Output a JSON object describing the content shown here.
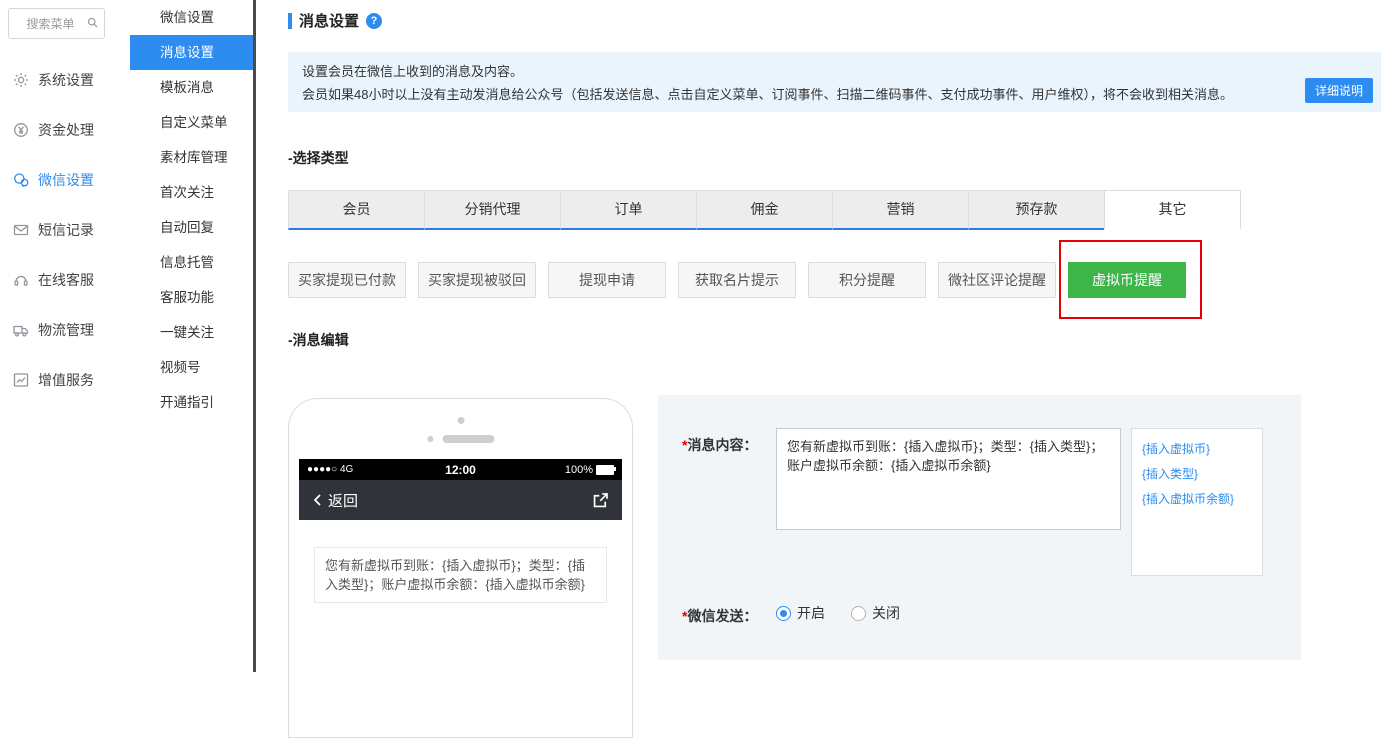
{
  "colors": {
    "accent": "#2d8cf0",
    "tab_underline": "#2c7be0",
    "active_green": "#3eb549",
    "annotation_red": "#e60000",
    "notice_bg": "#e9f4fd",
    "submenu_active_bg": "#2d8cf0"
  },
  "sidebar": {
    "search_placeholder": "搜索菜单",
    "items": [
      {
        "label": "系统设置",
        "icon": "gear-icon"
      },
      {
        "label": "资金处理",
        "icon": "money-icon"
      },
      {
        "label": "微信设置",
        "icon": "wechat-icon",
        "active": true
      },
      {
        "label": "短信记录",
        "icon": "mail-icon"
      },
      {
        "label": "在线客服",
        "icon": "headset-icon"
      },
      {
        "label": "物流管理",
        "icon": "truck-icon"
      },
      {
        "label": "增值服务",
        "icon": "chart-icon"
      }
    ]
  },
  "submenu": {
    "active": "消息设置",
    "items": [
      "微信设置",
      "消息设置",
      "模板消息",
      "自定义菜单",
      "素材库管理",
      "首次关注",
      "自动回复",
      "信息托管",
      "客服功能",
      "一键关注",
      "视频号",
      "开通指引"
    ]
  },
  "main": {
    "title": "消息设置",
    "help_mark": "?",
    "notice": {
      "line1": "设置会员在微信上收到的消息及内容。",
      "line2": "会员如果48小时以上没有主动发消息给公众号（包括发送信息、点击自定义菜单、订阅事件、扫描二维码事件、支付成功事件、用户维权），将不会收到相关消息。",
      "button": "详细说明"
    },
    "select_type_label": "-选择类型",
    "tabs": [
      "会员",
      "分销代理",
      "订单",
      "佣金",
      "营销",
      "预存款",
      "其它"
    ],
    "active_tab": "其它",
    "subtypes": [
      "买家提现已付款",
      "买家提现被驳回",
      "提现申请",
      "获取名片提示",
      "积分提醒",
      "微社区评论提醒",
      "虚拟币提醒"
    ],
    "active_subtype": "虚拟币提醒",
    "edit_label": "-消息编辑",
    "phone": {
      "signal": "●●●●○ 4G",
      "time": "12:00",
      "battery": "100%",
      "back_label": "返回",
      "message": "您有新虚拟币到账：{插入虚拟币}；类型：{插入类型}；账户虚拟币余额：{插入虚拟币余额}"
    },
    "form": {
      "required_mark": "*",
      "content_label": "消息内容：",
      "content_value": "您有新虚拟币到账：{插入虚拟币}；类型：{插入类型}；账户虚拟币余额：{插入虚拟币余额}",
      "insert_links": [
        "{插入虚拟币}",
        "{插入类型}",
        "{插入虚拟币余额}"
      ],
      "send_label": "微信发送：",
      "radio_on": "开启",
      "radio_off": "关闭",
      "radio_selected": "开启"
    }
  }
}
